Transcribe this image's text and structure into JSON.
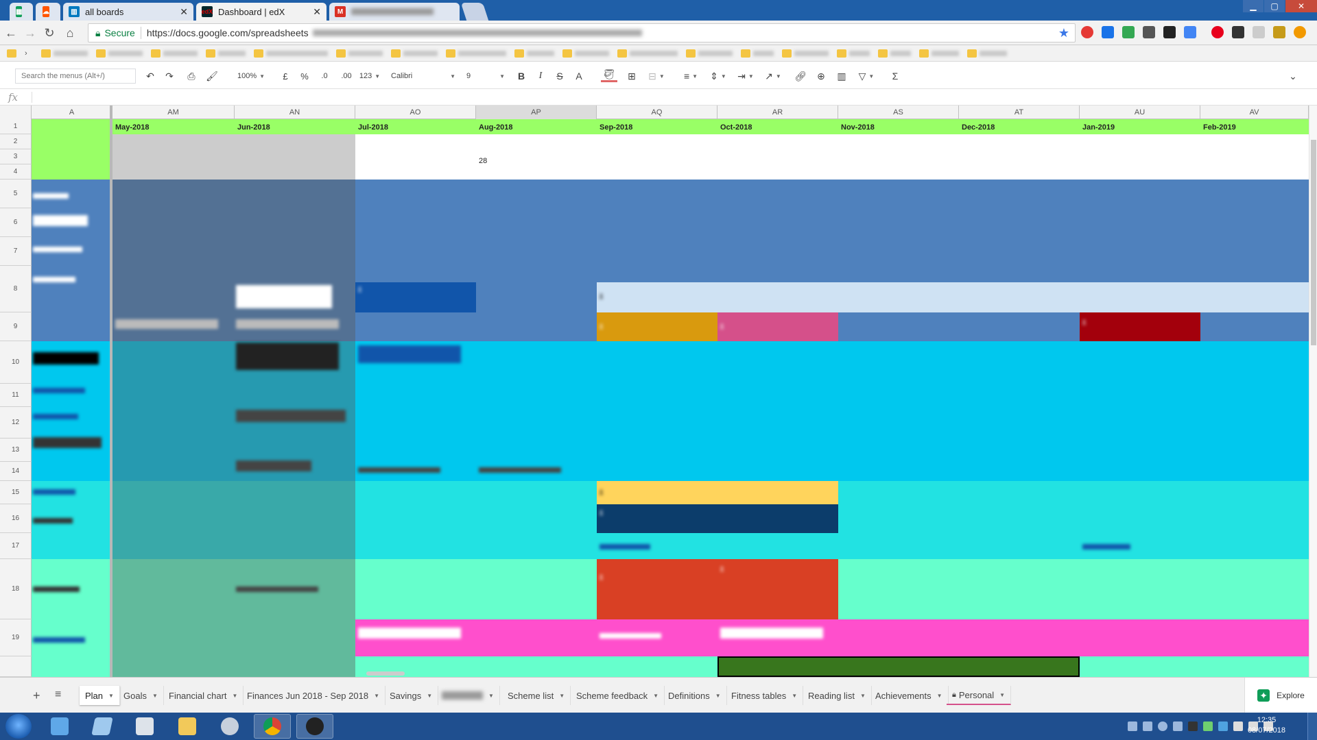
{
  "browser": {
    "tabs": [
      {
        "label": "",
        "icon": "sheets-icon",
        "color": "#0f9d58"
      },
      {
        "label": "",
        "icon": "soundcloud-icon",
        "color": "#ff5500"
      },
      {
        "label": "all boards",
        "icon": "trello-icon",
        "color": "#0079bf"
      },
      {
        "label": "Dashboard | edX",
        "icon": "edx-icon",
        "color": "#02262b"
      },
      {
        "label": "",
        "icon": "gmail-icon",
        "color": "#d93025"
      }
    ],
    "address": {
      "secure_label": "Secure",
      "url": "https://docs.google.com/spreadsheets"
    }
  },
  "toolbar": {
    "search_placeholder": "Search the menus (Alt+/)",
    "zoom": "100%",
    "currency": "£",
    "percent": "%",
    "dec_decrease": ".0",
    "dec_increase": ".00",
    "more_formats": "123",
    "font": "Calibri",
    "font_size": "9",
    "bold": "B",
    "italic": "I",
    "strike": "S",
    "text_color": "A",
    "sum": "Σ"
  },
  "formula_bar": {
    "fx": "fx",
    "value": ""
  },
  "grid": {
    "columns": [
      "A",
      "AM",
      "AN",
      "AO",
      "AP",
      "AQ",
      "AR",
      "AS",
      "AT",
      "AU",
      "AV"
    ],
    "selected_column": "AP",
    "rows": [
      "1",
      "2",
      "3",
      "4",
      "5",
      "6",
      "7",
      "8",
      "9",
      "10",
      "11",
      "12",
      "13",
      "14",
      "15",
      "16",
      "17",
      "18",
      "19"
    ],
    "months": [
      "May-2018",
      "Jun-2018",
      "Jul-2018",
      "Aug-2018",
      "Sep-2018",
      "Oct-2018",
      "Nov-2018",
      "Dec-2018",
      "Jan-2019",
      "Feb-2019"
    ],
    "value_ap3": "28",
    "colors": {
      "green_header": "#99ff66",
      "blue_band": "#4f81bd",
      "cyan_band": "#00c8ee",
      "turquoise_band": "#22e2e2",
      "mint_band": "#66ffcc",
      "pink_band": "#ff4fcc",
      "frozen_overlay": "rgba(90,90,90,0.45)",
      "orange": "#d99a0e",
      "rose": "#d5508a",
      "dark_red": "#a3000c",
      "navy": "#0c3d6b",
      "yellow": "#ffd45c",
      "red_orange": "#d94024",
      "light_blue": "#cfe2f3",
      "dark_green": "#38761d",
      "blue_note": "#1155aa"
    }
  },
  "sheet_tabs": [
    {
      "label": "Plan",
      "active": true
    },
    {
      "label": "Goals"
    },
    {
      "label": "Financial chart"
    },
    {
      "label": "Finances Jun 2018 - Sep 2018"
    },
    {
      "label": "Savings"
    },
    {
      "label": ""
    },
    {
      "label": "Scheme list"
    },
    {
      "label": "Scheme feedback"
    },
    {
      "label": "Definitions"
    },
    {
      "label": "Fitness tables"
    },
    {
      "label": "Reading list"
    },
    {
      "label": "Achievements"
    },
    {
      "label": "Personal",
      "locked": true
    }
  ],
  "explore_label": "Explore",
  "taskbar": {
    "time": "12:35",
    "date": "08/07/2018"
  }
}
